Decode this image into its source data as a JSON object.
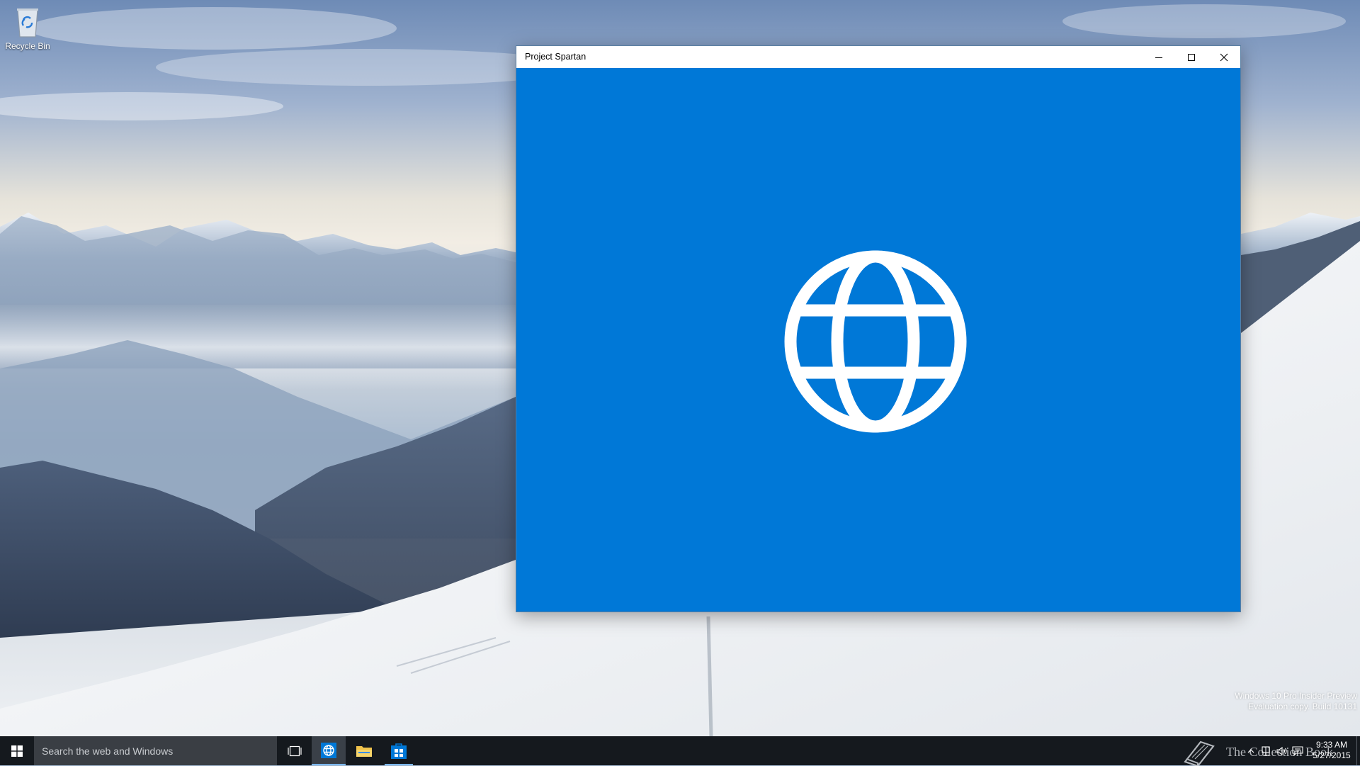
{
  "desktop": {
    "recycle_bin_label": "Recycle Bin"
  },
  "window": {
    "title": "Project Spartan",
    "controls": [
      "minimize",
      "maximize",
      "close"
    ],
    "splash_background": "#0078d7",
    "splash_icon": "globe-icon"
  },
  "watermark": {
    "line1": "Windows 10 Pro Insider Preview",
    "line2": "Evaluation copy. Build 10131"
  },
  "taskbar": {
    "search_placeholder": "Search the web and Windows",
    "pinned": [
      "task-view-icon",
      "project-spartan-icon",
      "file-explorer-icon",
      "store-icon"
    ],
    "active_app": "Project Spartan",
    "brand_text": "The Collection Book",
    "clock_time": "9:33 AM",
    "clock_date": "5/27/2015",
    "tray_icons": [
      "show-hidden-icons-chevron-icon",
      "network-icon",
      "volume-icon",
      "action-center-icon"
    ]
  },
  "colors": {
    "accent": "#0078d7",
    "taskbar": "#15191e",
    "search_box": "#3a3e44"
  }
}
